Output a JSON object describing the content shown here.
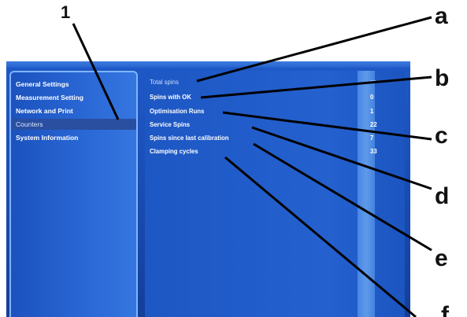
{
  "callouts": {
    "one": "1",
    "a": "a",
    "b": "b",
    "c": "c",
    "d": "d",
    "e": "e",
    "f": "f"
  },
  "sidebar": {
    "items": [
      {
        "label": "General Settings",
        "selected": false
      },
      {
        "label": "Measurement Setting",
        "selected": false
      },
      {
        "label": "Network and Print",
        "selected": false
      },
      {
        "label": "Counters",
        "selected": true
      },
      {
        "label": "System Information",
        "selected": false
      }
    ]
  },
  "counters": {
    "rows": [
      {
        "label": "Total spins",
        "value": "—"
      },
      {
        "label": "Spins with OK",
        "value": "0"
      },
      {
        "label": "Optimisation Runs",
        "value": "1"
      },
      {
        "label": "Service Spins",
        "value": "22"
      },
      {
        "label": "Spins since last calibration",
        "value": "7"
      },
      {
        "label": "Clamping cycles",
        "value": "33"
      }
    ]
  },
  "colors": {
    "screen_bg": "#1a4fb8",
    "panel_border": "#7fb4ff",
    "selected_row": "#2a4fa0",
    "text": "#ffffff",
    "leader_lines": "#000000"
  }
}
